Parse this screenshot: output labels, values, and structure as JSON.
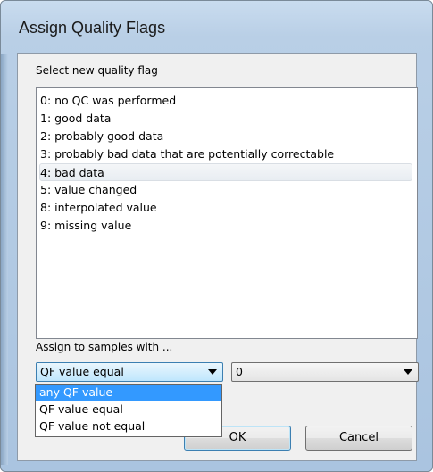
{
  "window": {
    "title": "Assign Quality Flags"
  },
  "list": {
    "label": "Select new quality flag",
    "items": [
      "0: no QC was performed",
      "1: good data",
      "2: probably good data",
      "3: probably bad data that are potentially correctable",
      "4: bad data",
      "5: value changed",
      "8: interpolated value",
      "9: missing value"
    ],
    "selected_index": 4
  },
  "assign": {
    "label": "Assign to samples with ...",
    "condition_value": "QF value equal",
    "flag_value": "0",
    "options": [
      "any QF value",
      "QF value equal",
      "QF value not equal"
    ],
    "highlighted_option_index": 0
  },
  "buttons": {
    "ok": "OK",
    "cancel": "Cancel"
  }
}
